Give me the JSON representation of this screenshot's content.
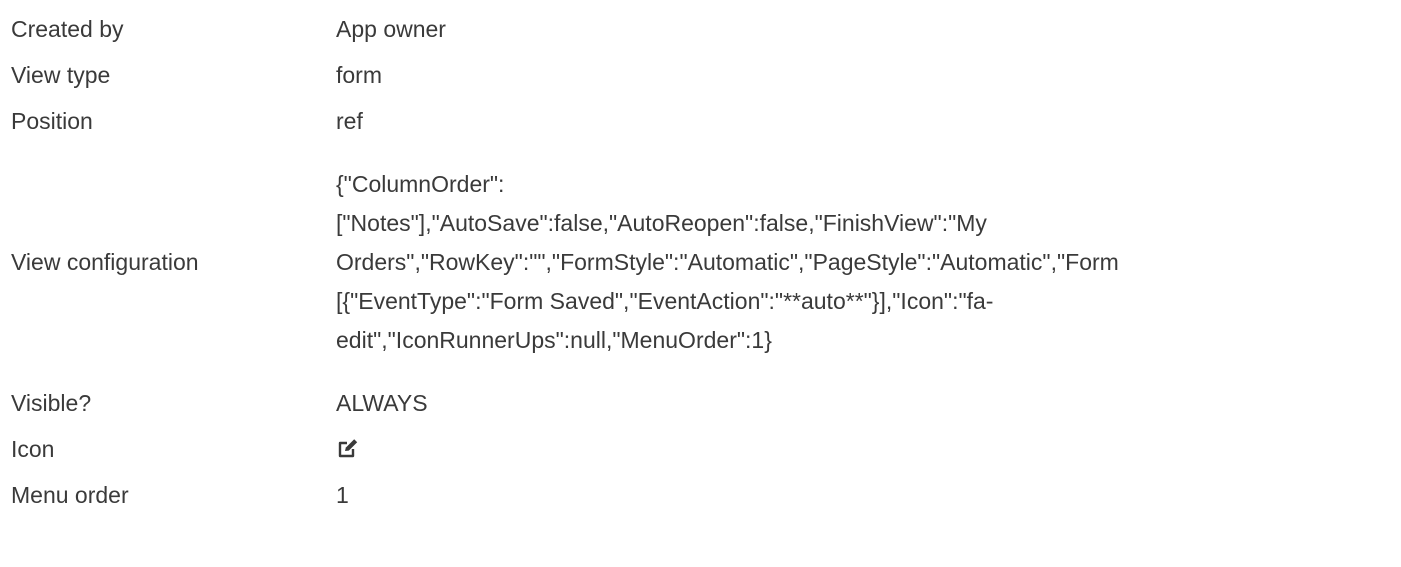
{
  "rows": [
    {
      "label": "Created by",
      "value": "App owner"
    },
    {
      "label": "View type",
      "value": "form"
    },
    {
      "label": "Position",
      "value": "ref"
    },
    {
      "label": "View configuration",
      "value_lines": [
        "{\"ColumnOrder\":",
        "[\"Notes\"],\"AutoSave\":false,\"AutoReopen\":false,\"FinishView\":\"My",
        "Orders\",\"RowKey\":\"\",\"FormStyle\":\"Automatic\",\"PageStyle\":\"Automatic\",\"Form",
        "[{\"EventType\":\"Form Saved\",\"EventAction\":\"**auto**\"}],\"Icon\":\"fa-",
        "edit\",\"IconRunnerUps\":null,\"MenuOrder\":1}"
      ]
    },
    {
      "label": "Visible?",
      "value": "ALWAYS"
    },
    {
      "label": "Icon",
      "icon": "edit-icon"
    },
    {
      "label": "Menu order",
      "value": "1"
    }
  ],
  "colors": {
    "text": "#3a3a3a",
    "background": "#ffffff"
  }
}
